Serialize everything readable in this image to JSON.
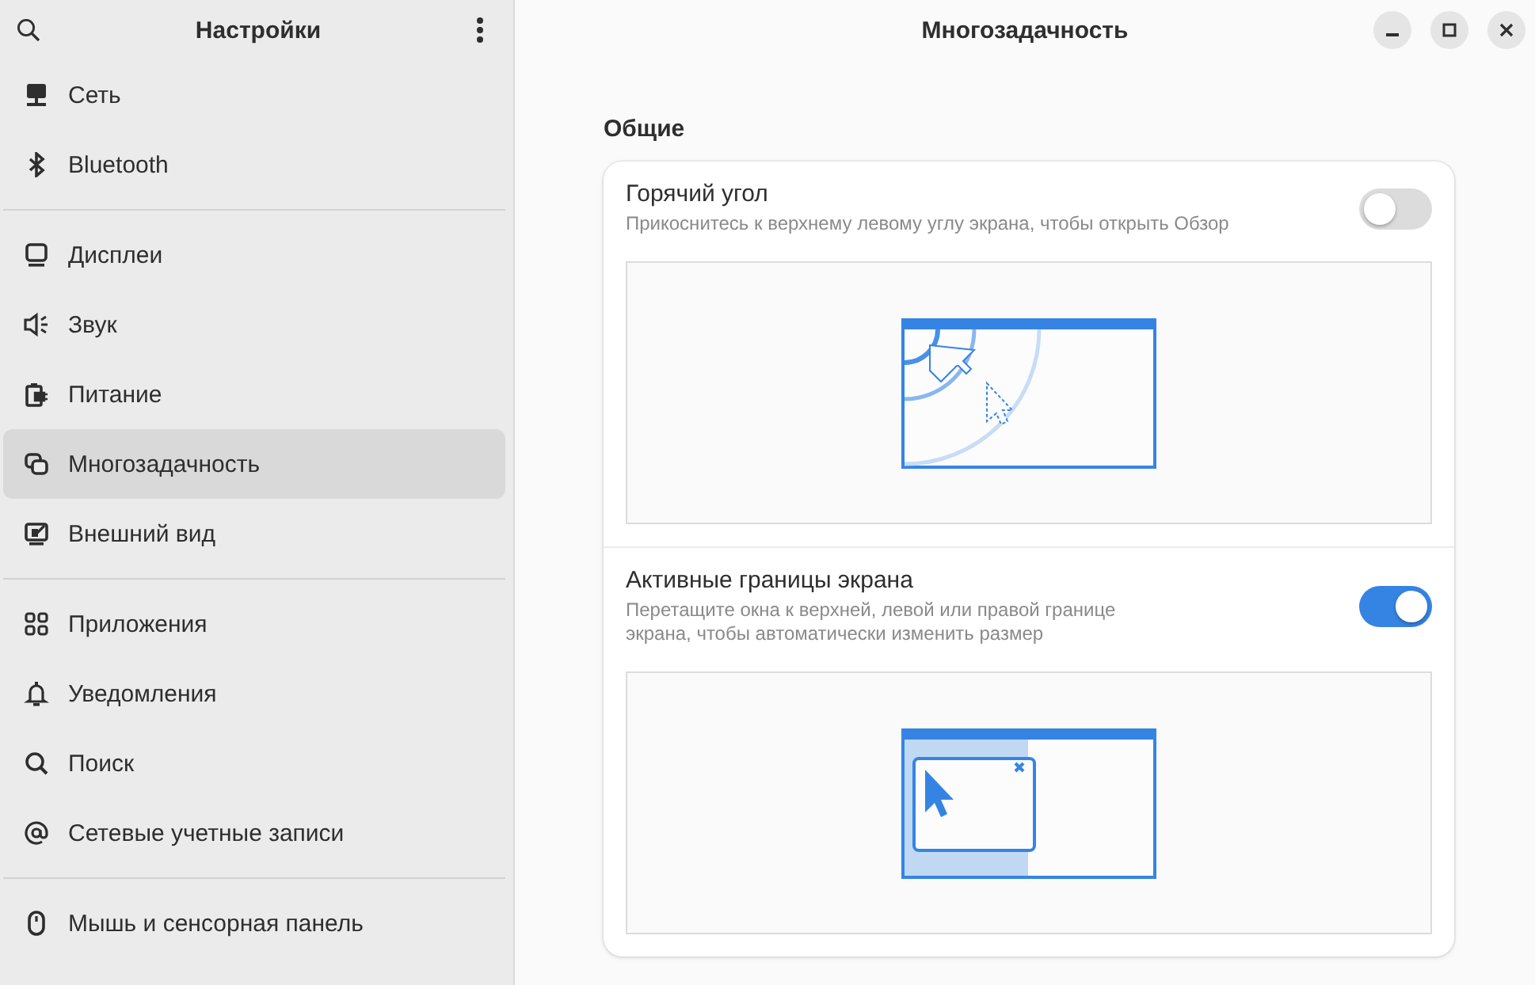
{
  "sidebar": {
    "title": "Настройки",
    "groups": [
      {
        "items": [
          {
            "label": "Сеть",
            "selected": false
          },
          {
            "label": "Bluetooth",
            "selected": false
          }
        ]
      },
      {
        "items": [
          {
            "label": "Дисплеи",
            "selected": false
          },
          {
            "label": "Звук",
            "selected": false
          },
          {
            "label": "Питание",
            "selected": false
          },
          {
            "label": "Многозадачность",
            "selected": true
          },
          {
            "label": "Внешний вид",
            "selected": false
          }
        ]
      },
      {
        "items": [
          {
            "label": "Приложения",
            "selected": false
          },
          {
            "label": "Уведомления",
            "selected": false
          },
          {
            "label": "Поиск",
            "selected": false
          },
          {
            "label": "Сетевые учетные записи",
            "selected": false
          }
        ]
      },
      {
        "items": [
          {
            "label": "Мышь и сенсорная панель",
            "selected": false
          }
        ]
      }
    ]
  },
  "window": {
    "title": "Многозадачность"
  },
  "section": {
    "title": "Общие",
    "rows": [
      {
        "kind": "hot-corner",
        "title": "Горячий угол",
        "subtitle": "Прикоснитесь к верхнему левому углу экрана, чтобы открыть Обзор",
        "on": false
      },
      {
        "kind": "edges",
        "title": "Активные границы экрана",
        "subtitle": "Перетащите окна к верхней, левой или правой границе\nэкрана, чтобы автоматически изменить размер",
        "on": true
      }
    ]
  }
}
